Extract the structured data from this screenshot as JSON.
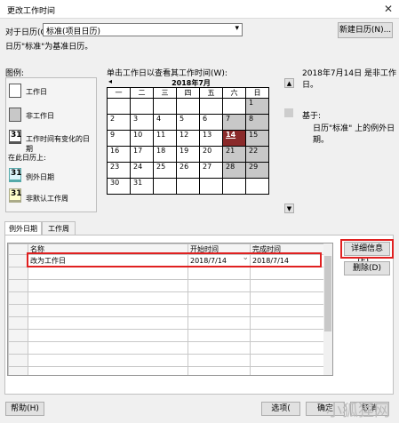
{
  "window": {
    "title": "更改工作时间",
    "close": "✕"
  },
  "calendar_select": {
    "label": "对于日历(C):",
    "value": "标准(项目日历)",
    "new_button": "新建日历(N)..."
  },
  "base_note": "日历\"标准\"为基准日历。",
  "legend": {
    "title": "图例:",
    "working": "工作日",
    "nonworking": "非工作日",
    "edited": "工作时间有变化的日期",
    "in_this_calendar": "在此日历上:",
    "exception": "例外日期",
    "nondefault": "非默认工作周",
    "day31": "31"
  },
  "calendar": {
    "instruction": "单击工作日以查看其工作时间(W):",
    "month": "2018年7月",
    "weekdays": [
      "一",
      "二",
      "三",
      "四",
      "五",
      "六",
      "日"
    ],
    "weeks": [
      [
        "",
        "",
        "",
        "",
        "",
        "",
        "1"
      ],
      [
        "2",
        "3",
        "4",
        "5",
        "6",
        "7",
        "8"
      ],
      [
        "9",
        "10",
        "11",
        "12",
        "13",
        "14",
        "15"
      ],
      [
        "16",
        "17",
        "18",
        "19",
        "20",
        "21",
        "22"
      ],
      [
        "23",
        "24",
        "25",
        "26",
        "27",
        "28",
        "29"
      ],
      [
        "30",
        "31",
        "",
        "",
        "",
        "",
        ""
      ]
    ],
    "selected_day": "14"
  },
  "info": {
    "status": "2018年7月14日 是非工作日。",
    "based_on": "基于:",
    "based_on_detail": "日历\"标准\" 上的例外日期。"
  },
  "tabs": [
    "例外日期",
    "工作周"
  ],
  "exceptions_table": {
    "headers": [
      "名称",
      "开始时间",
      "完成时间"
    ],
    "rows": [
      [
        "改为工作日",
        "2018/7/14",
        "2018/7/14"
      ]
    ]
  },
  "buttons": {
    "details": "详细信息(E)...",
    "delete": "删除(D)",
    "help": "帮助(H)",
    "options": "选项(",
    "ok": "确定",
    "cancel": "取消"
  },
  "watermark": "小狐狸网"
}
